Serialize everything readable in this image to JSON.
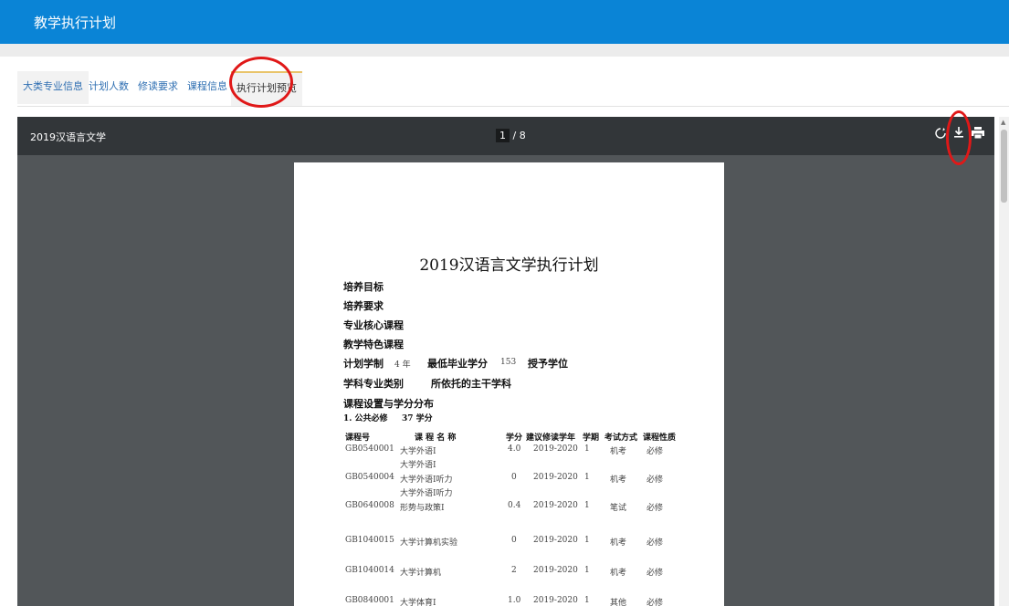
{
  "header": {
    "title": "教学执行计划"
  },
  "tabs": [
    {
      "label": "大类专业信息"
    },
    {
      "label": "计划人数"
    },
    {
      "label": "修读要求"
    },
    {
      "label": "课程信息"
    },
    {
      "label": "执行计划预览"
    }
  ],
  "viewer": {
    "doc_title": "2019汉语言文学",
    "page_current": "1",
    "page_total": "/ 8",
    "icons": [
      "rotate-icon",
      "download-icon",
      "print-icon"
    ]
  },
  "document": {
    "title": "2019汉语言文学执行计划",
    "sections": {
      "goal": "培养目标",
      "requirement": "培养要求",
      "core_courses": "专业核心课程",
      "featured_courses": "教学特色课程",
      "duration_label": "计划学制",
      "duration_value": "4 年",
      "min_credit_label": "最低毕业学分",
      "min_credit_value": "153",
      "degree_label": "授予学位",
      "category_label": "学科专业类别",
      "main_subject_label": "所依托的主干学科",
      "credit_dist": "课程设置与学分分布",
      "public_required": "1. 公共必修",
      "public_required_credits": "37 学分"
    },
    "table": {
      "headers": [
        "课程号",
        "课 程 名 称",
        "学分",
        "建议修读学年",
        "学期",
        "考试方式",
        "课程性质"
      ],
      "rows": [
        {
          "code": "GB0540001",
          "name": "大学外语Ⅰ",
          "name2": "大学外语Ⅰ",
          "credit": "4.0",
          "year": "2019-2020",
          "term": "1",
          "exam": "机考",
          "type": "必修"
        },
        {
          "code": "GB0540004",
          "name": "大学外语Ⅰ听力",
          "name2": "大学外语Ⅰ听力",
          "credit": "0",
          "year": "2019-2020",
          "term": "1",
          "exam": "机考",
          "type": "必修"
        },
        {
          "code": "GB0640008",
          "name": "形势与政策Ⅰ",
          "name2": "",
          "credit": "0.4",
          "year": "2019-2020",
          "term": "1",
          "exam": "笔试",
          "type": "必修"
        },
        {
          "code": "GB1040015",
          "name": "大学计算机实验",
          "name2": "",
          "credit": "0",
          "year": "2019-2020",
          "term": "1",
          "exam": "机考",
          "type": "必修"
        },
        {
          "code": "GB1040014",
          "name": "大学计算机",
          "name2": "",
          "credit": "2",
          "year": "2019-2020",
          "term": "1",
          "exam": "机考",
          "type": "必修"
        },
        {
          "code": "GB0840001",
          "name": "大学体育Ⅰ",
          "name2": "",
          "credit": "1.0",
          "year": "2019-2020",
          "term": "1",
          "exam": "其他",
          "type": "必修"
        }
      ]
    }
  },
  "colors": {
    "topbar": "#0a84d6",
    "annotation": "#e01818",
    "viewer_bg": "#525659",
    "toolbar": "#323639"
  }
}
